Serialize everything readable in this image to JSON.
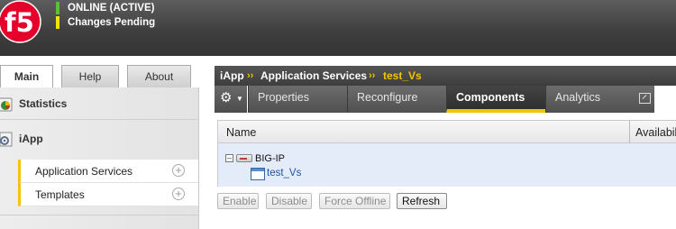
{
  "banner": {
    "status_online": "ONLINE (ACTIVE)",
    "status_changes": "Changes Pending",
    "online_color": "#57c13c",
    "changes_color": "#f4e300",
    "logo_color": "#e4002b"
  },
  "left_tabs": [
    {
      "label": "Main",
      "active": true
    },
    {
      "label": "Help",
      "active": false
    },
    {
      "label": "About",
      "active": false
    }
  ],
  "left_nav": {
    "statistics": {
      "label": "Statistics",
      "icon": "pie-chart-icon"
    },
    "iapp": {
      "label": "iApp",
      "icon": "gear-doc-icon",
      "items": [
        {
          "label": "Application Services",
          "icon": "plus-circle-icon"
        },
        {
          "label": "Templates",
          "icon": "plus-circle-icon"
        }
      ]
    }
  },
  "breadcrumb": {
    "part1": "iApp",
    "sep": "››",
    "part2": "Application Services",
    "current": "test_Vs"
  },
  "tabs": [
    {
      "label": "Properties",
      "active": false
    },
    {
      "label": "Reconfigure",
      "active": false
    },
    {
      "label": "Components",
      "active": true
    },
    {
      "label": "Analytics",
      "active": false
    }
  ],
  "accent_color": "#f5c400",
  "grid": {
    "columns": [
      "Name",
      "Availabil"
    ],
    "root": {
      "label": "BIG-IP",
      "expand_symbol": "–"
    },
    "child": {
      "label": "test_Vs"
    }
  },
  "actions": {
    "enable": "Enable",
    "disable": "Disable",
    "force_offline": "Force Offline",
    "refresh": "Refresh"
  }
}
